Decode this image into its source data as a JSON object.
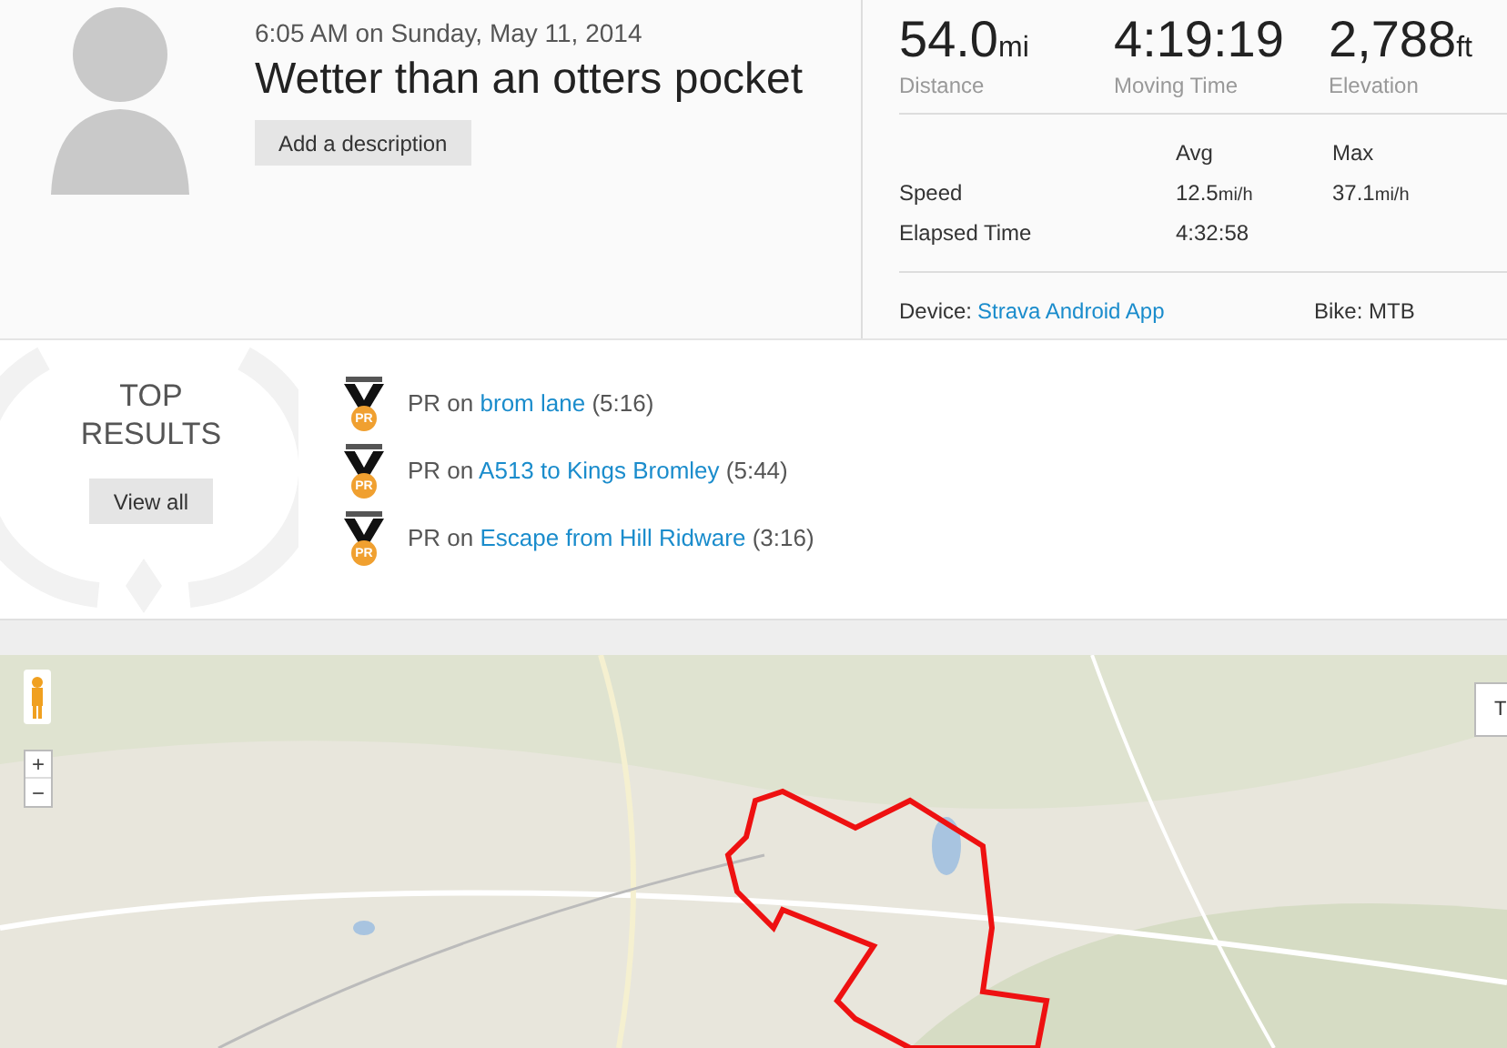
{
  "activity": {
    "datetime": "6:05 AM on Sunday, May 11, 2014",
    "title": "Wetter than an otters pocket",
    "description_button": "Add a description"
  },
  "stats": {
    "primary": [
      {
        "value": "54.0",
        "unit": "mi",
        "label": "Distance"
      },
      {
        "value": "4:19:19",
        "label": "Moving Time"
      },
      {
        "value": "2,788",
        "unit": "ft",
        "label": "Elevation"
      }
    ],
    "columns": [
      "Avg",
      "Max"
    ],
    "rows": [
      {
        "label": "Speed",
        "avg": "12.5",
        "avg_unit": "mi/h",
        "max": "37.1",
        "max_unit": "mi/h"
      },
      {
        "label": "Elapsed Time",
        "avg": "4:32:58"
      }
    ],
    "device_label": "Device:",
    "device": "Strava Android App",
    "bike": "Bike: MTB"
  },
  "top_results": {
    "title": "TOP RESULTS",
    "button": "View all",
    "items": [
      {
        "badge": "PR",
        "prefix": "PR on",
        "segment": "brom lane",
        "time": "(5:16)"
      },
      {
        "badge": "PR",
        "prefix": "PR on",
        "segment": "A513 to Kings Bromley",
        "time": "(5:44)"
      },
      {
        "badge": "PR",
        "prefix": "PR on",
        "segment": "Escape from Hill Ridware",
        "time": "(3:16)"
      }
    ]
  },
  "map": {
    "zoom_in": "+",
    "zoom_out": "−",
    "map_type_button": "T"
  }
}
